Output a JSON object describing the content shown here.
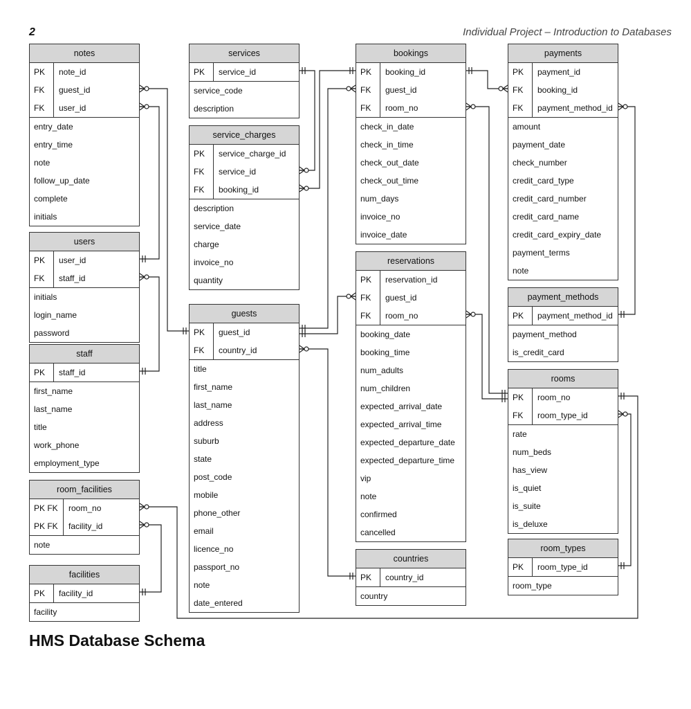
{
  "header": {
    "page_number": "2",
    "running_title": "Individual Project – Introduction to Databases"
  },
  "diagram_title": "HMS Database Schema",
  "entities": [
    {
      "id": "notes",
      "name": "notes",
      "fields": [
        {
          "key": "PK",
          "name": "note_id"
        },
        {
          "key": "FK",
          "name": "guest_id"
        },
        {
          "key": "FK",
          "name": "user_id"
        },
        {
          "key": "",
          "name": "entry_date"
        },
        {
          "key": "",
          "name": "entry_time"
        },
        {
          "key": "",
          "name": "note"
        },
        {
          "key": "",
          "name": "follow_up_date"
        },
        {
          "key": "",
          "name": "complete"
        },
        {
          "key": "",
          "name": "initials"
        }
      ]
    },
    {
      "id": "users",
      "name": "users",
      "fields": [
        {
          "key": "PK",
          "name": "user_id"
        },
        {
          "key": "FK",
          "name": "staff_id"
        },
        {
          "key": "",
          "name": "initials"
        },
        {
          "key": "",
          "name": "login_name"
        },
        {
          "key": "",
          "name": "password"
        }
      ]
    },
    {
      "id": "staff",
      "name": "staff",
      "fields": [
        {
          "key": "PK",
          "name": "staff_id"
        },
        {
          "key": "",
          "name": "first_name"
        },
        {
          "key": "",
          "name": "last_name"
        },
        {
          "key": "",
          "name": "title"
        },
        {
          "key": "",
          "name": "work_phone"
        },
        {
          "key": "",
          "name": "employment_type"
        }
      ]
    },
    {
      "id": "room_facilities",
      "name": "room_facilities",
      "fields": [
        {
          "key": "PK FK",
          "name": "room_no"
        },
        {
          "key": "PK FK",
          "name": "facility_id"
        },
        {
          "key": "",
          "name": "note"
        }
      ]
    },
    {
      "id": "facilities",
      "name": "facilities",
      "fields": [
        {
          "key": "PK",
          "name": "facility_id"
        },
        {
          "key": "",
          "name": "facility"
        }
      ]
    },
    {
      "id": "services",
      "name": "services",
      "fields": [
        {
          "key": "PK",
          "name": "service_id"
        },
        {
          "key": "",
          "name": "service_code"
        },
        {
          "key": "",
          "name": "description"
        }
      ]
    },
    {
      "id": "service_charges",
      "name": "service_charges",
      "fields": [
        {
          "key": "PK",
          "name": "service_charge_id"
        },
        {
          "key": "FK",
          "name": "service_id"
        },
        {
          "key": "FK",
          "name": "booking_id"
        },
        {
          "key": "",
          "name": "description"
        },
        {
          "key": "",
          "name": "service_date"
        },
        {
          "key": "",
          "name": "charge"
        },
        {
          "key": "",
          "name": "invoice_no"
        },
        {
          "key": "",
          "name": "quantity"
        }
      ]
    },
    {
      "id": "guests",
      "name": "guests",
      "fields": [
        {
          "key": "PK",
          "name": "guest_id"
        },
        {
          "key": "FK",
          "name": "country_id"
        },
        {
          "key": "",
          "name": "title"
        },
        {
          "key": "",
          "name": "first_name"
        },
        {
          "key": "",
          "name": "last_name"
        },
        {
          "key": "",
          "name": "address"
        },
        {
          "key": "",
          "name": "suburb"
        },
        {
          "key": "",
          "name": "state"
        },
        {
          "key": "",
          "name": "post_code"
        },
        {
          "key": "",
          "name": "mobile"
        },
        {
          "key": "",
          "name": "phone_other"
        },
        {
          "key": "",
          "name": "email"
        },
        {
          "key": "",
          "name": "licence_no"
        },
        {
          "key": "",
          "name": "passport_no"
        },
        {
          "key": "",
          "name": "note"
        },
        {
          "key": "",
          "name": "date_entered"
        }
      ]
    },
    {
      "id": "bookings",
      "name": "bookings",
      "fields": [
        {
          "key": "PK",
          "name": "booking_id"
        },
        {
          "key": "FK",
          "name": "guest_id"
        },
        {
          "key": "FK",
          "name": "room_no"
        },
        {
          "key": "",
          "name": "check_in_date"
        },
        {
          "key": "",
          "name": "check_in_time"
        },
        {
          "key": "",
          "name": "check_out_date"
        },
        {
          "key": "",
          "name": "check_out_time"
        },
        {
          "key": "",
          "name": "num_days"
        },
        {
          "key": "",
          "name": "invoice_no"
        },
        {
          "key": "",
          "name": "invoice_date"
        }
      ]
    },
    {
      "id": "reservations",
      "name": "reservations",
      "fields": [
        {
          "key": "PK",
          "name": "reservation_id"
        },
        {
          "key": "FK",
          "name": "guest_id"
        },
        {
          "key": "FK",
          "name": "room_no"
        },
        {
          "key": "",
          "name": "booking_date"
        },
        {
          "key": "",
          "name": "booking_time"
        },
        {
          "key": "",
          "name": "num_adults"
        },
        {
          "key": "",
          "name": "num_children"
        },
        {
          "key": "",
          "name": "expected_arrival_date"
        },
        {
          "key": "",
          "name": "expected_arrival_time"
        },
        {
          "key": "",
          "name": "expected_departure_date"
        },
        {
          "key": "",
          "name": "expected_departure_time"
        },
        {
          "key": "",
          "name": "vip"
        },
        {
          "key": "",
          "name": "note"
        },
        {
          "key": "",
          "name": "confirmed"
        },
        {
          "key": "",
          "name": "cancelled"
        }
      ]
    },
    {
      "id": "countries",
      "name": "countries",
      "fields": [
        {
          "key": "PK",
          "name": "country_id"
        },
        {
          "key": "",
          "name": "country"
        }
      ]
    },
    {
      "id": "payments",
      "name": "payments",
      "fields": [
        {
          "key": "PK",
          "name": "payment_id"
        },
        {
          "key": "FK",
          "name": "booking_id"
        },
        {
          "key": "FK",
          "name": "payment_method_id"
        },
        {
          "key": "",
          "name": "amount"
        },
        {
          "key": "",
          "name": "payment_date"
        },
        {
          "key": "",
          "name": "check_number"
        },
        {
          "key": "",
          "name": "credit_card_type"
        },
        {
          "key": "",
          "name": "credit_card_number"
        },
        {
          "key": "",
          "name": "credit_card_name"
        },
        {
          "key": "",
          "name": "credit_card_expiry_date"
        },
        {
          "key": "",
          "name": "payment_terms"
        },
        {
          "key": "",
          "name": "note"
        }
      ]
    },
    {
      "id": "payment_methods",
      "name": "payment_methods",
      "fields": [
        {
          "key": "PK",
          "name": "payment_method_id"
        },
        {
          "key": "",
          "name": "payment_method"
        },
        {
          "key": "",
          "name": "is_credit_card"
        }
      ]
    },
    {
      "id": "rooms",
      "name": "rooms",
      "fields": [
        {
          "key": "PK",
          "name": "room_no"
        },
        {
          "key": "FK",
          "name": "room_type_id"
        },
        {
          "key": "",
          "name": "rate"
        },
        {
          "key": "",
          "name": "num_beds"
        },
        {
          "key": "",
          "name": "has_view"
        },
        {
          "key": "",
          "name": "is_quiet"
        },
        {
          "key": "",
          "name": "is_suite"
        },
        {
          "key": "",
          "name": "is_deluxe"
        }
      ]
    },
    {
      "id": "room_types",
      "name": "room_types",
      "fields": [
        {
          "key": "PK",
          "name": "room_type_id"
        },
        {
          "key": "",
          "name": "room_type"
        }
      ]
    }
  ],
  "relationships": [
    {
      "from": "notes.guest_id",
      "to": "guests.guest_id",
      "cardinality": "many-to-one"
    },
    {
      "from": "notes.user_id",
      "to": "users.user_id",
      "cardinality": "many-to-one"
    },
    {
      "from": "users.staff_id",
      "to": "staff.staff_id",
      "cardinality": "many-to-one"
    },
    {
      "from": "room_facilities.room_no",
      "to": "rooms.room_no",
      "cardinality": "many-to-one"
    },
    {
      "from": "room_facilities.facility_id",
      "to": "facilities.facility_id",
      "cardinality": "many-to-one"
    },
    {
      "from": "service_charges.service_id",
      "to": "services.service_id",
      "cardinality": "many-to-one"
    },
    {
      "from": "service_charges.booking_id",
      "to": "bookings.booking_id",
      "cardinality": "many-to-one"
    },
    {
      "from": "bookings.guest_id",
      "to": "guests.guest_id",
      "cardinality": "many-to-one"
    },
    {
      "from": "bookings.room_no",
      "to": "rooms.room_no",
      "cardinality": "many-to-one"
    },
    {
      "from": "reservations.guest_id",
      "to": "guests.guest_id",
      "cardinality": "many-to-one"
    },
    {
      "from": "reservations.room_no",
      "to": "rooms.room_no",
      "cardinality": "many-to-one"
    },
    {
      "from": "guests.country_id",
      "to": "countries.country_id",
      "cardinality": "many-to-one"
    },
    {
      "from": "payments.booking_id",
      "to": "bookings.booking_id",
      "cardinality": "many-to-one"
    },
    {
      "from": "payments.payment_method_id",
      "to": "payment_methods.payment_method_id",
      "cardinality": "many-to-one"
    },
    {
      "from": "rooms.room_type_id",
      "to": "room_types.room_type_id",
      "cardinality": "many-to-one"
    }
  ]
}
